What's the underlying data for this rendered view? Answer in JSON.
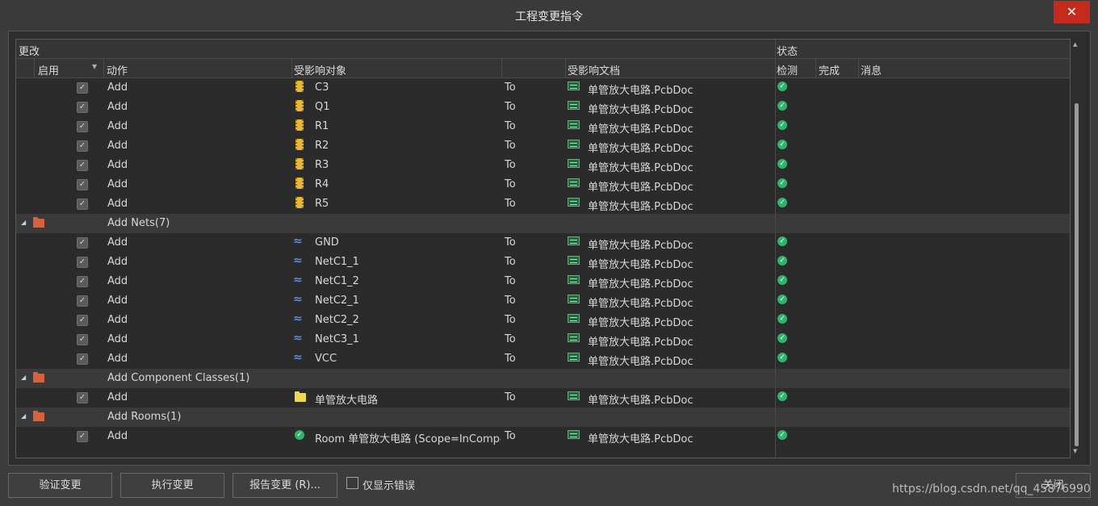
{
  "window": {
    "title": "工程变更指令",
    "close_glyph": "✕"
  },
  "headers": {
    "group_changes": "更改",
    "group_status": "状态",
    "col_enable": "启用",
    "col_action": "动作",
    "col_target": "受影响对象",
    "col_doc": "受影响文档",
    "col_check": "检测",
    "col_done": "完成",
    "col_message": "消息"
  },
  "rows": [
    {
      "type": "item",
      "action": "Add",
      "icon": "component-icon",
      "target": "C3",
      "to": "To",
      "doc": "单管放大电路.PcbDoc",
      "check": true
    },
    {
      "type": "item",
      "action": "Add",
      "icon": "component-icon",
      "target": "Q1",
      "to": "To",
      "doc": "单管放大电路.PcbDoc",
      "check": true
    },
    {
      "type": "item",
      "action": "Add",
      "icon": "component-icon",
      "target": "R1",
      "to": "To",
      "doc": "单管放大电路.PcbDoc",
      "check": true
    },
    {
      "type": "item",
      "action": "Add",
      "icon": "component-icon",
      "target": "R2",
      "to": "To",
      "doc": "单管放大电路.PcbDoc",
      "check": true
    },
    {
      "type": "item",
      "action": "Add",
      "icon": "component-icon",
      "target": "R3",
      "to": "To",
      "doc": "单管放大电路.PcbDoc",
      "check": true
    },
    {
      "type": "item",
      "action": "Add",
      "icon": "component-icon",
      "target": "R4",
      "to": "To",
      "doc": "单管放大电路.PcbDoc",
      "check": true
    },
    {
      "type": "item",
      "action": "Add",
      "icon": "component-icon",
      "target": "R5",
      "to": "To",
      "doc": "单管放大电路.PcbDoc",
      "check": true
    },
    {
      "type": "group",
      "label": "Add Nets(7)"
    },
    {
      "type": "item",
      "action": "Add",
      "icon": "net-icon",
      "target": "GND",
      "to": "To",
      "doc": "单管放大电路.PcbDoc",
      "check": true
    },
    {
      "type": "item",
      "action": "Add",
      "icon": "net-icon",
      "target": "NetC1_1",
      "to": "To",
      "doc": "单管放大电路.PcbDoc",
      "check": true
    },
    {
      "type": "item",
      "action": "Add",
      "icon": "net-icon",
      "target": "NetC1_2",
      "to": "To",
      "doc": "单管放大电路.PcbDoc",
      "check": true
    },
    {
      "type": "item",
      "action": "Add",
      "icon": "net-icon",
      "target": "NetC2_1",
      "to": "To",
      "doc": "单管放大电路.PcbDoc",
      "check": true
    },
    {
      "type": "item",
      "action": "Add",
      "icon": "net-icon",
      "target": "NetC2_2",
      "to": "To",
      "doc": "单管放大电路.PcbDoc",
      "check": true
    },
    {
      "type": "item",
      "action": "Add",
      "icon": "net-icon",
      "target": "NetC3_1",
      "to": "To",
      "doc": "单管放大电路.PcbDoc",
      "check": true
    },
    {
      "type": "item",
      "action": "Add",
      "icon": "net-icon",
      "target": "VCC",
      "to": "To",
      "doc": "单管放大电路.PcbDoc",
      "check": true
    },
    {
      "type": "group",
      "label": "Add Component Classes(1)"
    },
    {
      "type": "item",
      "action": "Add",
      "icon": "folder-icon",
      "target": "单管放大电路",
      "to": "To",
      "doc": "单管放大电路.PcbDoc",
      "check": true
    },
    {
      "type": "group",
      "label": "Add Rooms(1)"
    },
    {
      "type": "item",
      "action": "Add",
      "icon": "room-icon",
      "target": "Room 单管放大电路 (Scope=InComponentClass('单管放大电路'))",
      "to": "To",
      "doc": "单管放大电路.PcbDoc",
      "check": true
    }
  ],
  "buttons": {
    "validate": "验证变更",
    "execute": "执行变更",
    "report": "报告变更 (R)...",
    "close": "关闭"
  },
  "only_errors_label": "仅显示错误",
  "watermark": "https://blog.csdn.net/qq_45876990"
}
